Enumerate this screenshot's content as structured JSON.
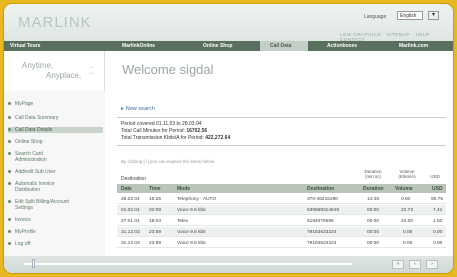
{
  "header": {
    "logo": "MARLINK",
    "language_label": "Language",
    "language_value": "English",
    "links": [
      "LOW GRAPHICS",
      "SITEMAP",
      "HELP",
      "CONTACT"
    ]
  },
  "nav": {
    "items": [
      "Virtual Tours",
      "MarlinkOnline",
      "Online Shop",
      "Call Data",
      "Actionboxes",
      "Marlink.com"
    ]
  },
  "tagline": {
    "line1": "Anytime,",
    "line2": "Anyplace,"
  },
  "welcome": "Welcome sigdal",
  "sidebar": {
    "items": [
      "MyPage",
      "Call Data Summary",
      "Call Data Details",
      "Online Shop",
      "Search Card",
      "Administration",
      "Add/edit Sub User",
      "Automatic Invoice",
      "Distribution",
      "Edit Split Billing/Account",
      "Settings",
      "Invoice",
      "MyProfile",
      "Log off"
    ]
  },
  "content": {
    "new_search": "New search",
    "summary": {
      "period": "Period covered 01.11.03 to 28.03.04",
      "minutes_label": "Total Call Minutes for Period:",
      "minutes_value": "16702.56",
      "kbits_label": "Total Transmission Kbits/A for Period:",
      "kbits_value": "422,272.64"
    },
    "hint": "By clicking [+] you can expand the items below.",
    "destination": "Destination",
    "top_headers": {
      "duration": "Duration (min:sc)",
      "volume": "Volume (Kbits/A)",
      "usd": "USD"
    },
    "columns": [
      "Date",
      "Time",
      "Mode",
      "Destination",
      "Duration",
      "Volume",
      "USD"
    ],
    "rows": [
      {
        "date": "28.03.04",
        "time": "16:25",
        "mode": "Telephony - AUTO",
        "dest": "370-46216290",
        "duration": "14:48",
        "volume": "0.00",
        "usd": "90.75"
      },
      {
        "date": "01.02.04",
        "time": "02:08",
        "mode": "Voice 9.6 kbit",
        "dest": "639868314649",
        "duration": "00:00",
        "volume": "22.73",
        "usd": "7.41"
      },
      {
        "date": "27.01.04",
        "time": "18:03",
        "mode": "Telex",
        "dest": "5194075696",
        "duration": "00:00",
        "volume": "24.00",
        "usd": "1.50"
      },
      {
        "date": "31.12.03",
        "time": "23:59",
        "mode": "Voice 9.6 kbit",
        "dest": "79163623224",
        "duration": "00:00",
        "volume": "0.00",
        "usd": "0.00"
      },
      {
        "date": "31.12.03",
        "time": "23:59",
        "mode": "Voice 9.6 kbit",
        "dest": "79163623224",
        "duration": "00:00",
        "volume": "0.00",
        "usd": "0.00"
      }
    ]
  },
  "bottom": {
    "btn1": "«",
    "btn2": "‹",
    "btn3": "›"
  }
}
